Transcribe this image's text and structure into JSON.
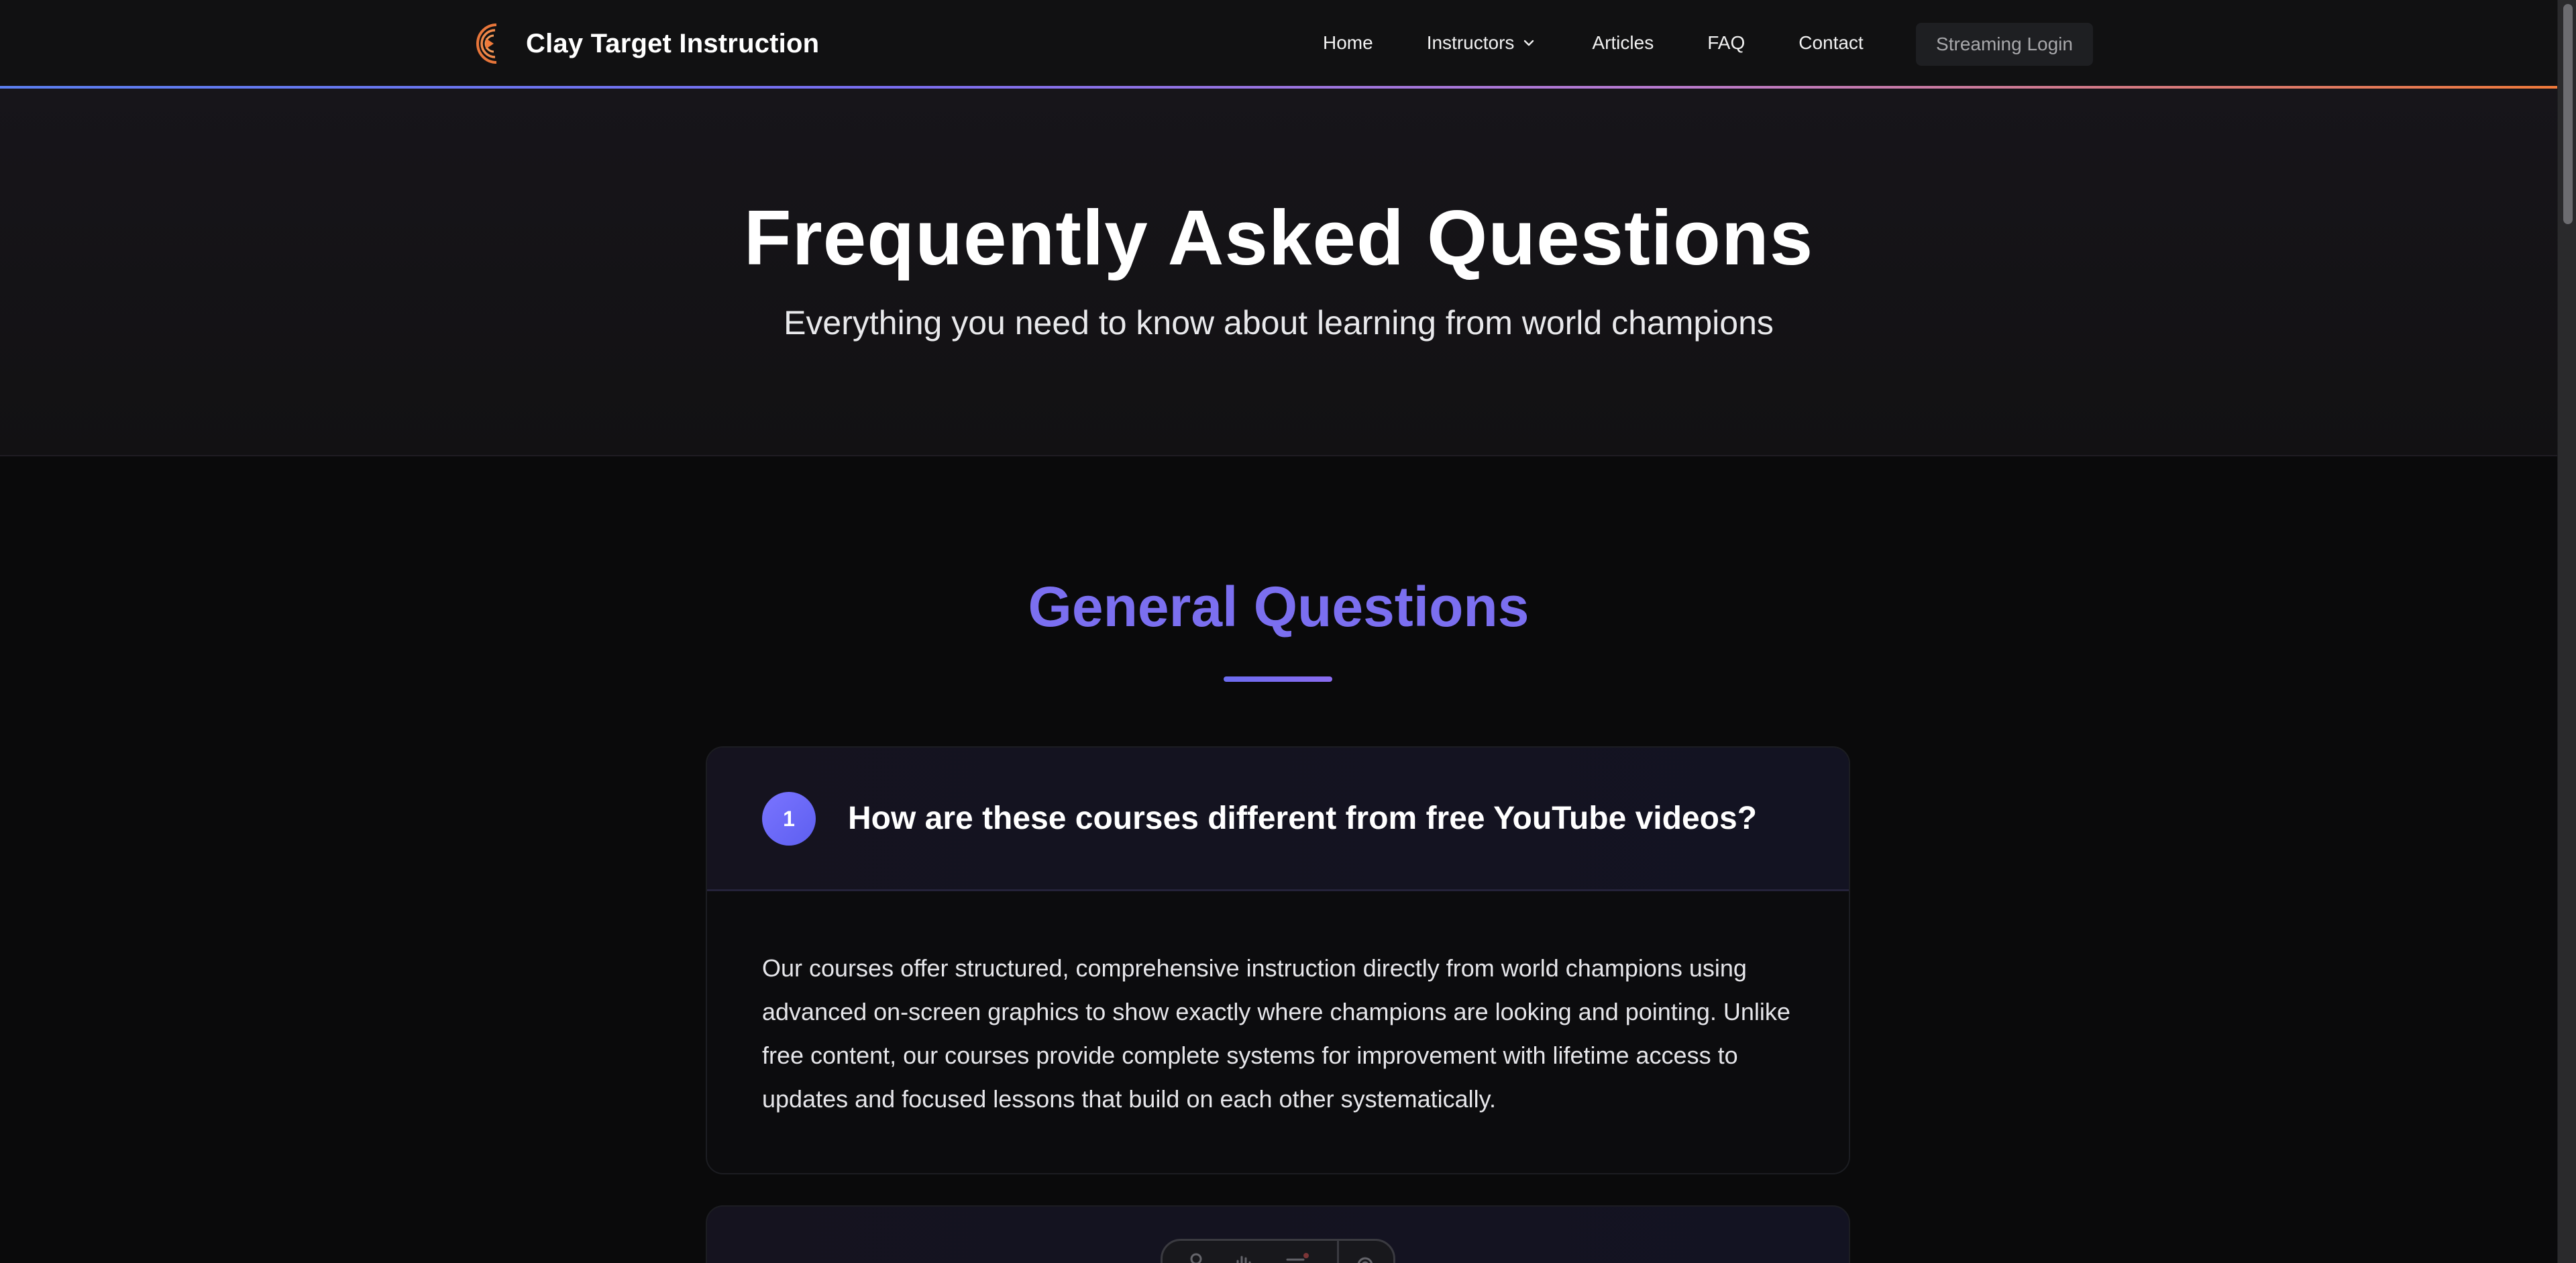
{
  "nav": {
    "brand_name": "Clay Target Instruction",
    "links": {
      "home": "Home",
      "instructors": "Instructors",
      "articles": "Articles",
      "faq": "FAQ",
      "contact": "Contact"
    },
    "login_label": "Streaming Login"
  },
  "hero": {
    "title": "Frequently Asked Questions",
    "subtitle": "Everything you need to know about learning from world champions"
  },
  "section": {
    "title": "General Questions"
  },
  "faqs": [
    {
      "number": "1",
      "question": "How are these courses different from free YouTube videos?",
      "answer": "Our courses offer structured, comprehensive instruction directly from world champions using advanced on-screen graphics to show exactly where champions are looking and pointing. Unlike free content, our courses provide complete systems for improvement with lifetime access to updates and focused lessons that build on each other systematically."
    }
  ],
  "colors": {
    "accent": "#7b6ff0",
    "brand_orange": "#f07a3a",
    "nav_bg": "#111112",
    "page_bg": "#0a0a0b"
  }
}
